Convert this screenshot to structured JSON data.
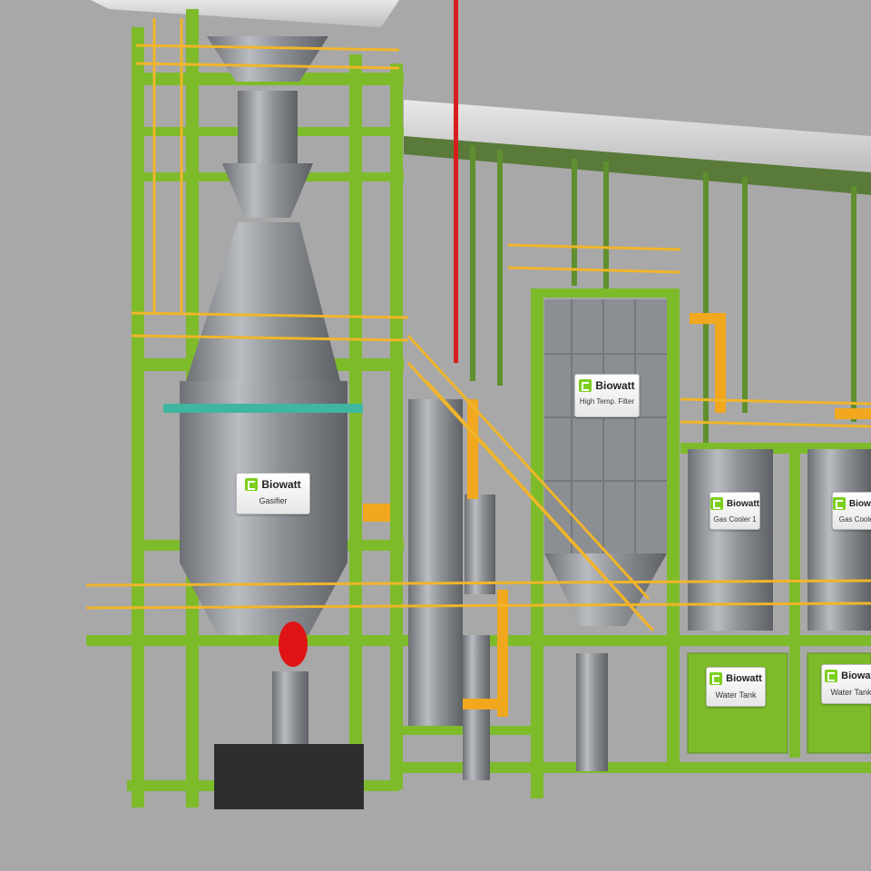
{
  "brand": "Biowatt",
  "labels": {
    "gasifier": "Gasifier",
    "filter": "High Temp. Filter",
    "cooler1": "Gas Cooler 1",
    "cooler2": "Gas Cooler",
    "tank1": "Water Tank",
    "tank2": "Water Tank"
  },
  "colors": {
    "frame": "#7dbb2a",
    "vessel": "#8d9094",
    "railing": "#f0b52a",
    "background": "#a8a8a8"
  }
}
